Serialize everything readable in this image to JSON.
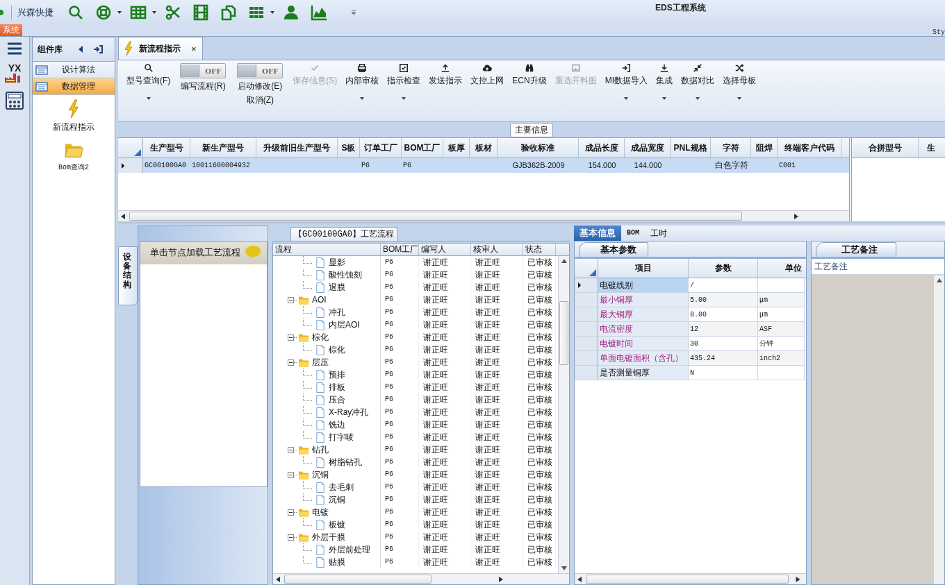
{
  "app": {
    "title": "EDS工程系统",
    "quick_access": {
      "label": "兴森快捷",
      "tools": [
        {
          "dropdown": false
        },
        {
          "dropdown": true
        },
        {
          "dropdown": true
        },
        {
          "dropdown": false
        },
        {
          "dropdown": false
        },
        {
          "dropdown": false
        },
        {
          "dropdown": true
        },
        {
          "dropdown": false
        },
        {
          "dropdown": false
        }
      ]
    },
    "ribbon_tabs": [
      {
        "label": "系统",
        "selected": true
      }
    ],
    "style_label": "Sty"
  },
  "side_strip": {
    "logo_text": "YX"
  },
  "component_library": {
    "title": "组件库",
    "groups": [
      {
        "label": "设计算法",
        "selected": false
      },
      {
        "label": "数据管理",
        "selected": true
      }
    ],
    "tools": [
      {
        "label": "新流程指示"
      },
      {
        "label": "Bom查询2"
      }
    ]
  },
  "document_tabs": [
    {
      "label": "新流程指示",
      "close": "×",
      "selected": true
    }
  ],
  "toolbar": [
    {
      "kind": "button",
      "label": "型号查询(F)",
      "disabled": false,
      "dropdown": true
    },
    {
      "kind": "toggle",
      "label": "编写流程(R)",
      "toggle_text": "OFF",
      "on": false
    },
    {
      "kind": "toggle",
      "label": "启动修改(E)",
      "sub_label": "取消(Z)",
      "toggle_text": "OFF",
      "on": false
    },
    {
      "kind": "button",
      "label": "保存信息(S)",
      "disabled": true,
      "dropdown": false
    },
    {
      "kind": "button",
      "label": "内部审核",
      "disabled": false,
      "dropdown": true
    },
    {
      "kind": "button",
      "label": "指示检查",
      "disabled": false,
      "dropdown": true
    },
    {
      "kind": "button",
      "label": "发送指示",
      "disabled": false,
      "dropdown": false
    },
    {
      "kind": "button",
      "label": "文控上网",
      "disabled": false,
      "dropdown": false
    },
    {
      "kind": "button",
      "label": "ECN升级",
      "disabled": false,
      "dropdown": false
    },
    {
      "kind": "button",
      "label": "重选开料图",
      "disabled": true,
      "dropdown": false
    },
    {
      "kind": "button",
      "label": "MI数据导入",
      "disabled": false,
      "dropdown": true
    },
    {
      "kind": "button",
      "label": "集成",
      "disabled": false,
      "dropdown": true
    },
    {
      "kind": "button",
      "label": "数据对比",
      "disabled": false,
      "dropdown": true
    },
    {
      "kind": "button",
      "label": "选择母板",
      "disabled": false,
      "dropdown": true
    }
  ],
  "main_info": {
    "title": "主要信息",
    "columns": [
      "生产型号",
      "新生产型号",
      "升级前旧生产型号",
      "S板",
      "订单工厂",
      "BOM工厂",
      "板厚",
      "板材",
      "验收标准",
      "成品长度",
      "成品宽度",
      "PNL规格",
      "字符",
      "阻焊",
      "终端客户代码"
    ],
    "rows": [
      {
        "selected": true,
        "cells": [
          "GC00100GA0",
          "10011600004932",
          null,
          null,
          "P6",
          "P6",
          null,
          null,
          "GJB362B-2009",
          "154.000",
          "144.000",
          null,
          "白色字符",
          null,
          "C001"
        ]
      }
    ],
    "side_columns": [
      "合拼型号",
      "生"
    ]
  },
  "structure": {
    "tab": "设备结构",
    "hint": "单击节点加载工艺流程"
  },
  "process_flow": {
    "title": "【GC00100GA0】工艺流程",
    "columns": [
      "流程",
      "BOM工厂",
      "编写人",
      "核审人",
      "状态"
    ],
    "rows": [
      {
        "kind": "leaf",
        "name": "显影",
        "bom": "P6",
        "writer": "谢正旺",
        "reviewer": "谢正旺",
        "status": "已审核"
      },
      {
        "kind": "leaf",
        "name": "酸性蚀刻",
        "bom": "P6",
        "writer": "谢正旺",
        "reviewer": "谢正旺",
        "status": "已审核"
      },
      {
        "kind": "leaf",
        "name": "退膜",
        "bom": "P6",
        "writer": "谢正旺",
        "reviewer": "谢正旺",
        "status": "已审核"
      },
      {
        "kind": "folder",
        "name": "AOI",
        "bom": "P6",
        "writer": "谢正旺",
        "reviewer": "谢正旺",
        "status": "已审核",
        "expanded": true,
        "children": [
          {
            "kind": "leaf",
            "name": "冲孔",
            "bom": "P6",
            "writer": "谢正旺",
            "reviewer": "谢正旺",
            "status": "已审核"
          },
          {
            "kind": "leaf",
            "name": "内层AOI",
            "bom": "P6",
            "writer": "谢正旺",
            "reviewer": "谢正旺",
            "status": "已审核"
          }
        ]
      },
      {
        "kind": "folder",
        "name": "棕化",
        "bom": "P6",
        "writer": "谢正旺",
        "reviewer": "谢正旺",
        "status": "已审核",
        "expanded": true,
        "children": [
          {
            "kind": "leaf",
            "name": "棕化",
            "bom": "P6",
            "writer": "谢正旺",
            "reviewer": "谢正旺",
            "status": "已审核"
          }
        ]
      },
      {
        "kind": "folder",
        "name": "层压",
        "bom": "P6",
        "writer": "谢正旺",
        "reviewer": "谢正旺",
        "status": "已审核",
        "expanded": true,
        "children": [
          {
            "kind": "leaf",
            "name": "预排",
            "bom": "P6",
            "writer": "谢正旺",
            "reviewer": "谢正旺",
            "status": "已审核"
          },
          {
            "kind": "leaf",
            "name": "排板",
            "bom": "P6",
            "writer": "谢正旺",
            "reviewer": "谢正旺",
            "status": "已审核"
          },
          {
            "kind": "leaf",
            "name": "压合",
            "bom": "P6",
            "writer": "谢正旺",
            "reviewer": "谢正旺",
            "status": "已审核"
          },
          {
            "kind": "leaf",
            "name": "X-Ray冲孔",
            "bom": "P6",
            "writer": "谢正旺",
            "reviewer": "谢正旺",
            "status": "已审核"
          },
          {
            "kind": "leaf",
            "name": "铣边",
            "bom": "P6",
            "writer": "谢正旺",
            "reviewer": "谢正旺",
            "status": "已审核"
          },
          {
            "kind": "leaf",
            "name": "打字唛",
            "bom": "P6",
            "writer": "谢正旺",
            "reviewer": "谢正旺",
            "status": "已审核"
          }
        ]
      },
      {
        "kind": "folder",
        "name": "钻孔",
        "bom": "P6",
        "writer": "谢正旺",
        "reviewer": "谢正旺",
        "status": "已审核",
        "expanded": true,
        "children": [
          {
            "kind": "leaf",
            "name": "树脂钻孔",
            "bom": "P6",
            "writer": "谢正旺",
            "reviewer": "谢正旺",
            "status": "已审核"
          }
        ]
      },
      {
        "kind": "folder",
        "name": "沉铜",
        "bom": "P6",
        "writer": "谢正旺",
        "reviewer": "谢正旺",
        "status": "已审核",
        "expanded": true,
        "children": [
          {
            "kind": "leaf",
            "name": "去毛刺",
            "bom": "P6",
            "writer": "谢正旺",
            "reviewer": "谢正旺",
            "status": "已审核"
          },
          {
            "kind": "leaf",
            "name": "沉铜",
            "bom": "P6",
            "writer": "谢正旺",
            "reviewer": "谢正旺",
            "status": "已审核"
          }
        ]
      },
      {
        "kind": "folder",
        "name": "电镀",
        "bom": "P6",
        "writer": "谢正旺",
        "reviewer": "谢正旺",
        "status": "已审核",
        "expanded": true,
        "children": [
          {
            "kind": "leaf",
            "name": "板镀",
            "bom": "P6",
            "writer": "谢正旺",
            "reviewer": "谢正旺",
            "status": "已审核"
          }
        ]
      },
      {
        "kind": "folder",
        "name": "外层干膜",
        "bom": "P6",
        "writer": "谢正旺",
        "reviewer": "谢正旺",
        "status": "已审核",
        "expanded": true,
        "children": [
          {
            "kind": "leaf",
            "name": "外层前处理",
            "bom": "P6",
            "writer": "谢正旺",
            "reviewer": "谢正旺",
            "status": "已审核"
          },
          {
            "kind": "leaf",
            "name": "贴膜",
            "bom": "P6",
            "writer": "谢正旺",
            "reviewer": "谢正旺",
            "status": "已审核"
          }
        ]
      }
    ]
  },
  "detail_tabs": [
    {
      "label": "基本信息",
      "selected": true
    },
    {
      "label": "BOM",
      "selected": false
    },
    {
      "label": "工时",
      "selected": false
    }
  ],
  "basic_params": {
    "title": "基本参数",
    "columns": [
      "项目",
      "参数",
      "单位"
    ],
    "rows": [
      {
        "item": "电镀线别",
        "value": "/",
        "highlighted": false,
        "selected": true
      },
      {
        "item": "最小铜厚",
        "value": "5.00",
        "unit": "μm",
        "highlighted": true,
        "selected": false
      },
      {
        "item": "最大铜厚",
        "value": "8.00",
        "unit": "μm",
        "highlighted": true,
        "selected": false
      },
      {
        "item": "电流密度",
        "value": "12",
        "unit": "ASF",
        "highlighted": true,
        "selected": false
      },
      {
        "item": "电镀时间",
        "value": "30",
        "unit": "分钟",
        "highlighted": true,
        "selected": false
      },
      {
        "item": "单面电镀面积（含孔）",
        "value": "435.24",
        "unit": "inch2",
        "highlighted": true,
        "selected": false
      },
      {
        "item": "是否测量铜厚",
        "value": "N",
        "highlighted": false,
        "selected": false
      }
    ]
  },
  "notes": {
    "title": "工艺备注",
    "label": "工艺备注"
  }
}
